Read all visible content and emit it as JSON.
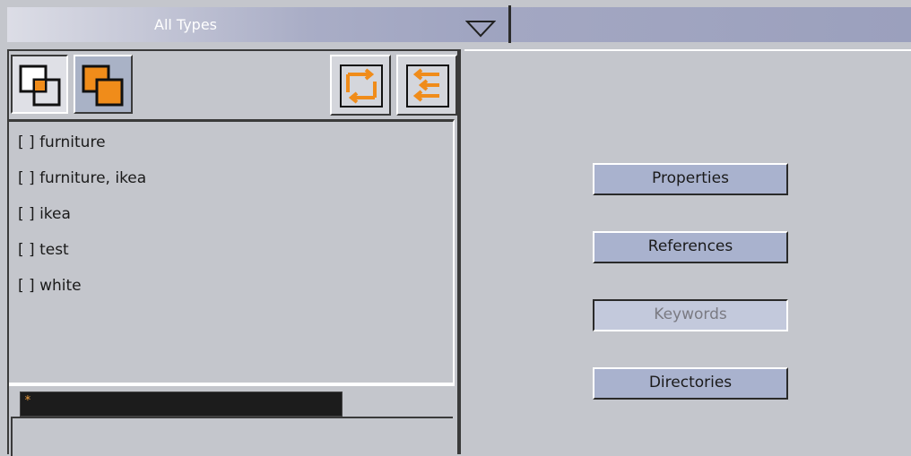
{
  "type_filter": {
    "selected": "All Types",
    "arrow_icon": "triangle-down-icon"
  },
  "toolbar": {
    "btn_a_icon": "overlap-squares-icon",
    "btn_b_icon": "overlap-squares-orange-icon",
    "btn_c_icon": "swap-arrows-icon",
    "btn_d_icon": "transfer-arrows-icon"
  },
  "keywords": [
    {
      "text": "[ ] furniture"
    },
    {
      "text": "[ ] furniture, ikea"
    },
    {
      "text": "[ ] ikea"
    },
    {
      "text": "[ ] test"
    },
    {
      "text": "[ ] white"
    }
  ],
  "filter": {
    "value": "*"
  },
  "side_buttons": {
    "properties": "Properties",
    "references": "References",
    "keywords": "Keywords",
    "directories": "Directories"
  },
  "colors": {
    "accent_orange": "#f08c1a",
    "button_blue": "#a9b2ce",
    "panel_gray": "#c4c6cc"
  }
}
